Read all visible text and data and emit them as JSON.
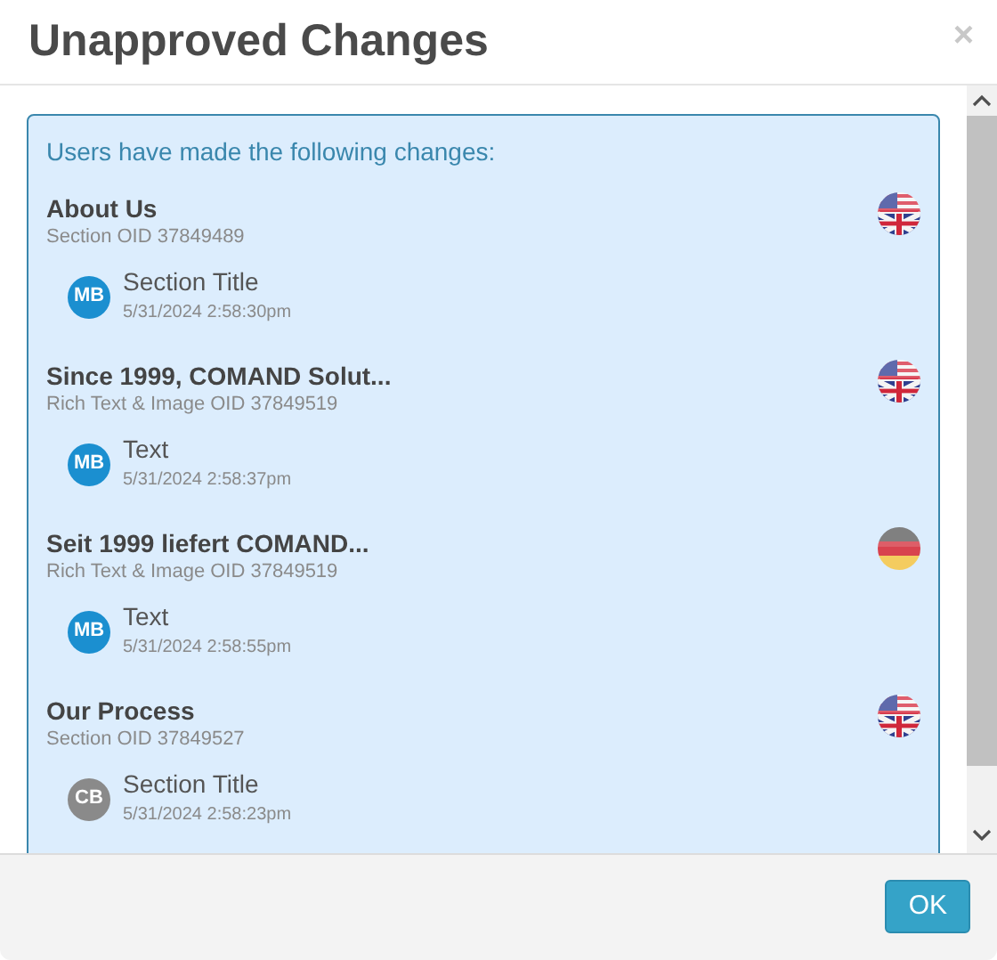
{
  "dialog": {
    "title": "Unapproved Changes",
    "close": "×"
  },
  "intro": "Users have made the following changes:",
  "groups": [
    {
      "title": "About Us",
      "subtitle": "Section OID 37849489",
      "flag": {
        "kind": "us_uk"
      },
      "changes": [
        {
          "initials": "MB",
          "color": "#1b8fd0",
          "field": "Section Title",
          "time": "5/31/2024 2:58:30pm"
        }
      ]
    },
    {
      "title": "Since 1999, COMAND Solut...",
      "subtitle": "Rich Text & Image OID 37849519",
      "flag": {
        "kind": "us_uk"
      },
      "changes": [
        {
          "initials": "MB",
          "color": "#1b8fd0",
          "field": "Text",
          "time": "5/31/2024 2:58:37pm"
        }
      ]
    },
    {
      "title": "Seit 1999 liefert COMAND...",
      "subtitle": "Rich Text & Image OID 37849519",
      "flag": {
        "kind": "de"
      },
      "changes": [
        {
          "initials": "MB",
          "color": "#1b8fd0",
          "field": "Text",
          "time": "5/31/2024 2:58:55pm"
        }
      ]
    },
    {
      "title": "Our Process",
      "subtitle": "Section OID 37849527",
      "flag": {
        "kind": "us_uk"
      },
      "changes": [
        {
          "initials": "CB",
          "color": "#8a8a8a",
          "field": "Section Title",
          "time": "5/31/2024 2:58:23pm"
        }
      ]
    }
  ],
  "buttons": [
    {
      "label": "OK"
    }
  ]
}
